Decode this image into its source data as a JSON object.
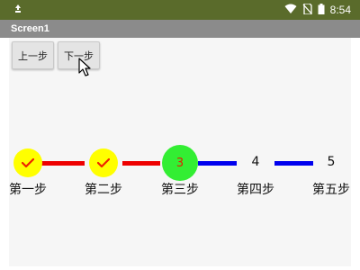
{
  "status_bar": {
    "left_icon": "notification-icon",
    "time": "8:54",
    "icons": [
      "wifi-icon",
      "no-sim-icon",
      "battery-icon"
    ]
  },
  "title_bar": {
    "title": "Screen1"
  },
  "buttons": {
    "prev_label": "上一步",
    "next_label": "下一步"
  },
  "stepper": {
    "current_step": 3,
    "colors": {
      "done": "#ffff00",
      "current": "#33ee33",
      "line_done": "#ee0000",
      "line_pending": "#0000ee",
      "check": "#ee2200"
    },
    "steps": [
      {
        "label": "第一步",
        "state": "done",
        "icon": "check-icon"
      },
      {
        "label": "第二步",
        "state": "done",
        "icon": "check-icon"
      },
      {
        "label": "第三步",
        "state": "current",
        "number": "3"
      },
      {
        "label": "第四步",
        "state": "pending",
        "number": "4"
      },
      {
        "label": "第五步",
        "state": "pending",
        "number": "5"
      }
    ]
  }
}
